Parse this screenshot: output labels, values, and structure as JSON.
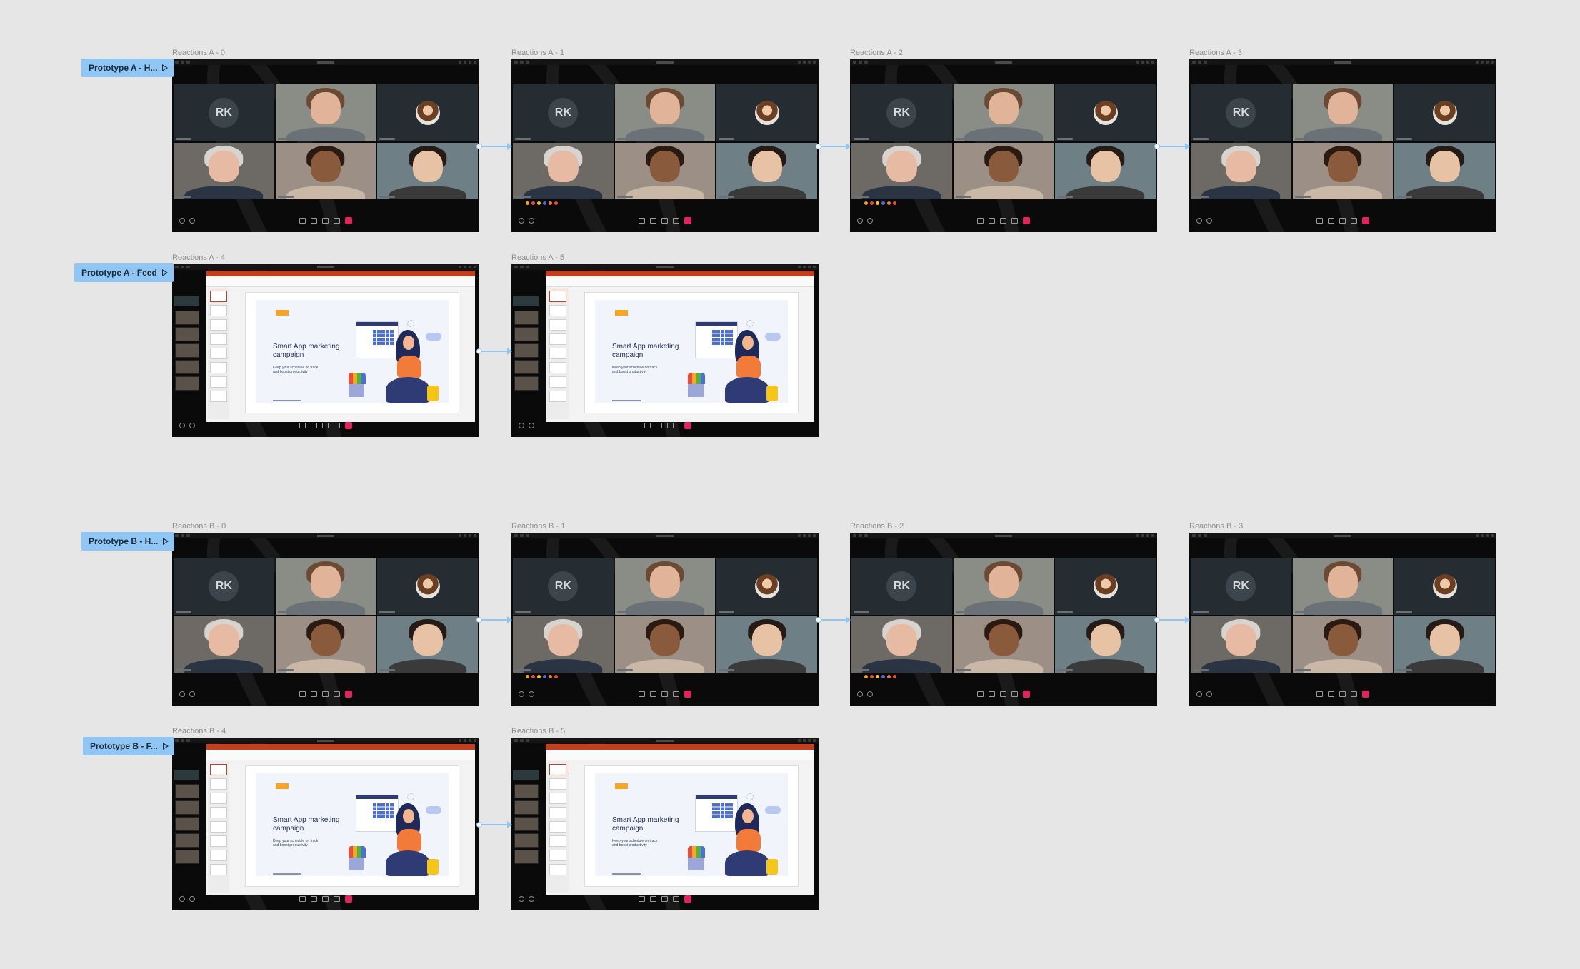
{
  "frames": [
    {
      "label": "Reactions A - 0",
      "kind": "grid",
      "reactions": false
    },
    {
      "label": "Reactions A - 1",
      "kind": "grid",
      "reactions": true
    },
    {
      "label": "Reactions A - 2",
      "kind": "grid",
      "reactions": true
    },
    {
      "label": "Reactions A - 3",
      "kind": "grid",
      "reactions": false
    },
    {
      "label": "Reactions A - 4",
      "kind": "presentation"
    },
    {
      "label": "Reactions A - 5",
      "kind": "presentation"
    },
    {
      "label": "Reactions B - 0",
      "kind": "grid",
      "reactions": false
    },
    {
      "label": "Reactions B - 1",
      "kind": "grid",
      "reactions": true
    },
    {
      "label": "Reactions B - 2",
      "kind": "grid",
      "reactions": true
    },
    {
      "label": "Reactions B - 3",
      "kind": "grid",
      "reactions": false
    },
    {
      "label": "Reactions B - 4",
      "kind": "presentation"
    },
    {
      "label": "Reactions B - 5",
      "kind": "presentation"
    }
  ],
  "prototypes": [
    {
      "label": "Prototype A - H..."
    },
    {
      "label": "Prototype A - Feed"
    },
    {
      "label": "Prototype B - H..."
    },
    {
      "label": "Prototype B - F..."
    }
  ],
  "tiles": {
    "avatar_initials": "RK"
  },
  "slide": {
    "title": "Smart App marketing campaign",
    "subtitle": "Keep your schedule on track and boost productivity"
  },
  "colors": {
    "canvas": "#e6e6e6",
    "prototype_tag": "#8fc6f3",
    "leave_button": "#e0245e",
    "slide_accent": "#f5a623",
    "ppt_ribbon": "#c43e1c"
  }
}
